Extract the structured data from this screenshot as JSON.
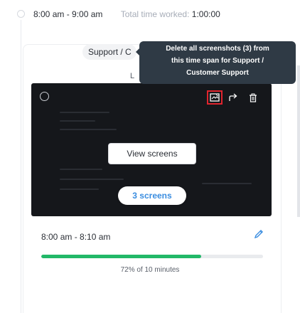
{
  "header": {
    "time_range": "8:00 am - 9:00 am",
    "total_label": "Total time worked: ",
    "total_value": "1:00:00"
  },
  "card": {
    "project_label": "Support / C",
    "under_letter": "L",
    "view_button": "View screens",
    "screens_count": "3 screens",
    "time_range": "8:00 am - 8:10 am",
    "progress": {
      "percent": 72,
      "text": "72% of 10 minutes"
    }
  },
  "tooltip": {
    "lines": [
      "Delete all screenshots (3) from",
      "this time span for Support /",
      "Customer Support"
    ]
  },
  "toolbar": {
    "icons": [
      "screenshot-blur-icon",
      "share-icon",
      "trash-icon"
    ]
  },
  "colors": {
    "accent": "#3a8de0",
    "progress": "#22b868",
    "highlight": "#e0242e",
    "tooltip_bg": "#2f3a45"
  }
}
